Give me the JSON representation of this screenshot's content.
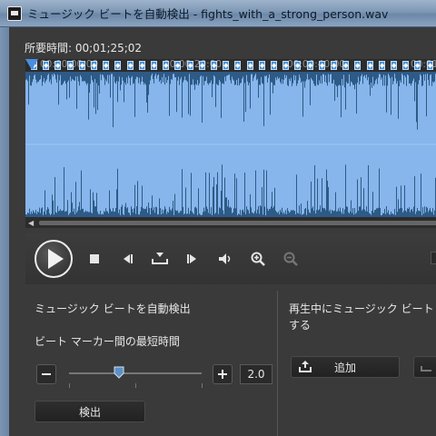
{
  "window": {
    "title": "ミュージック ビートを自動検出 - fights_with_a_strong_person.wav"
  },
  "duration": {
    "label": "所要時間: 00;01;25;02"
  },
  "timeline": {
    "ticks": [
      "00:00:00:00",
      "00:00:20:00",
      "00:00:40:00",
      "00:01:0"
    ]
  },
  "left_panel": {
    "heading": "ミュージック ビートを自動検出",
    "min_time_label": "ビート マーカー間の最短時間",
    "slider_value_fraction": 0.38,
    "value": "2.0",
    "detect_button": "検出"
  },
  "right_panel": {
    "line1": "再生中にミュージック ビート",
    "line2": "する",
    "add_button": "追加"
  },
  "icons": {
    "app": "app-icon",
    "play": "play-icon",
    "stop": "stop-icon",
    "prev": "previous-beat-icon",
    "add_marker": "add-marker-icon",
    "next": "next-beat-icon",
    "volume": "volume-icon",
    "zoom_in": "zoom-in-icon",
    "zoom_out": "zoom-out-icon"
  },
  "colors": {
    "waveform_bg": "#86b6ec",
    "waveform_fg": "#2e5a86",
    "beat_marker": "#4b93d8",
    "panel_bg": "#3a3a3a"
  }
}
